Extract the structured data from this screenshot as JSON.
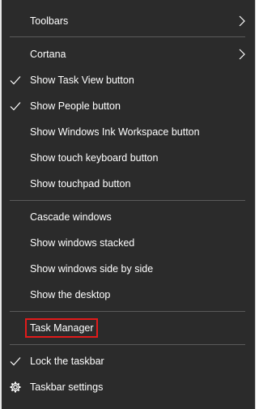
{
  "menu": {
    "items": [
      {
        "label": "Toolbars"
      },
      {
        "label": "Cortana"
      },
      {
        "label": "Show Task View button"
      },
      {
        "label": "Show People button"
      },
      {
        "label": "Show Windows Ink Workspace button"
      },
      {
        "label": "Show touch keyboard button"
      },
      {
        "label": "Show touchpad button"
      },
      {
        "label": "Cascade windows"
      },
      {
        "label": "Show windows stacked"
      },
      {
        "label": "Show windows side by side"
      },
      {
        "label": "Show the desktop"
      },
      {
        "label": "Task Manager"
      },
      {
        "label": "Lock the taskbar"
      },
      {
        "label": "Taskbar settings"
      }
    ],
    "checked": [
      "Show Task View button",
      "Show People button",
      "Lock the taskbar"
    ],
    "submenu_items": [
      "Toolbars",
      "Cortana"
    ]
  },
  "colors": {
    "menu_background": "#2b2b2b",
    "menu_text": "#ffffff",
    "separator": "#5a5a5a",
    "highlight_box": "#e21b1b"
  },
  "icons": {
    "check": "checkmark-icon",
    "submenu": "chevron-right-icon",
    "settings": "gear-icon"
  }
}
